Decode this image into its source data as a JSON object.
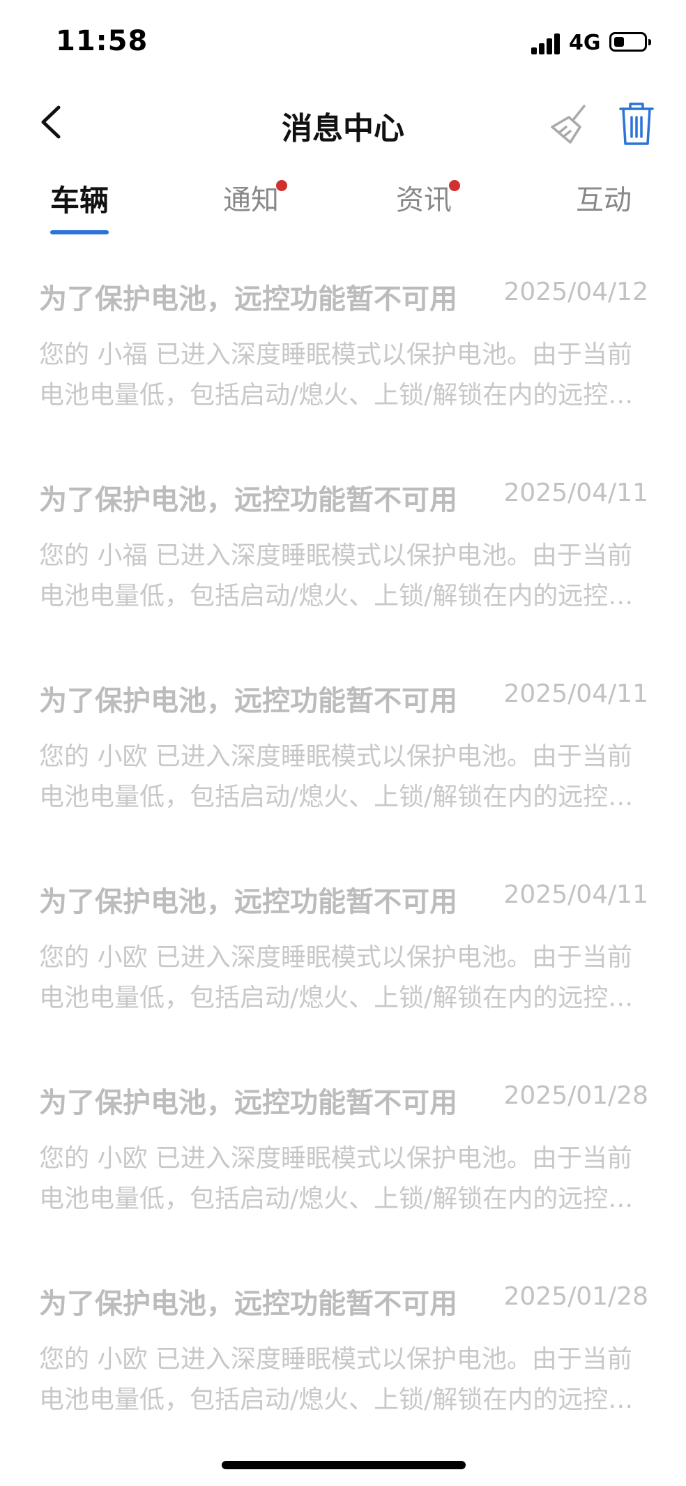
{
  "status_bar": {
    "time": "11:58",
    "network": "4G"
  },
  "header": {
    "title": "消息中心"
  },
  "tabs": [
    {
      "label": "车辆",
      "active": true,
      "dot": false
    },
    {
      "label": "通知",
      "active": false,
      "dot": true
    },
    {
      "label": "资讯",
      "active": false,
      "dot": true
    },
    {
      "label": "互动",
      "active": false,
      "dot": false
    }
  ],
  "messages": [
    {
      "title": "为了保护电池，远控功能暂不可用",
      "date": "2025/04/12",
      "line1": "您的 小福 已进入深度睡眠模式以保护电池。由于当前",
      "line2": "电池电量低，包括启动/熄火、上锁/解锁在内的远控…"
    },
    {
      "title": "为了保护电池，远控功能暂不可用",
      "date": "2025/04/11",
      "line1": "您的 小福 已进入深度睡眠模式以保护电池。由于当前",
      "line2": "电池电量低，包括启动/熄火、上锁/解锁在内的远控…"
    },
    {
      "title": "为了保护电池，远控功能暂不可用",
      "date": "2025/04/11",
      "line1": "您的 小欧 已进入深度睡眠模式以保护电池。由于当前",
      "line2": "电池电量低，包括启动/熄火、上锁/解锁在内的远控…"
    },
    {
      "title": "为了保护电池，远控功能暂不可用",
      "date": "2025/04/11",
      "line1": "您的 小欧 已进入深度睡眠模式以保护电池。由于当前",
      "line2": "电池电量低，包括启动/熄火、上锁/解锁在内的远控…"
    },
    {
      "title": "为了保护电池，远控功能暂不可用",
      "date": "2025/01/28",
      "line1": "您的 小欧 已进入深度睡眠模式以保护电池。由于当前",
      "line2": "电池电量低，包括启动/熄火、上锁/解锁在内的远控…"
    },
    {
      "title": "为了保护电池，远控功能暂不可用",
      "date": "2025/01/28",
      "line1": "您的 小欧 已进入深度睡眠模式以保护电池。由于当前",
      "line2": "电池电量低，包括启动/熄火、上锁/解锁在内的远控…"
    }
  ],
  "icons": {
    "back": "chevron-left-icon",
    "clear": "broom-icon",
    "delete": "trash-icon"
  },
  "colors": {
    "accent": "#2a74d8",
    "badge": "#d0302e",
    "muted_text": "#c8c8c8"
  }
}
